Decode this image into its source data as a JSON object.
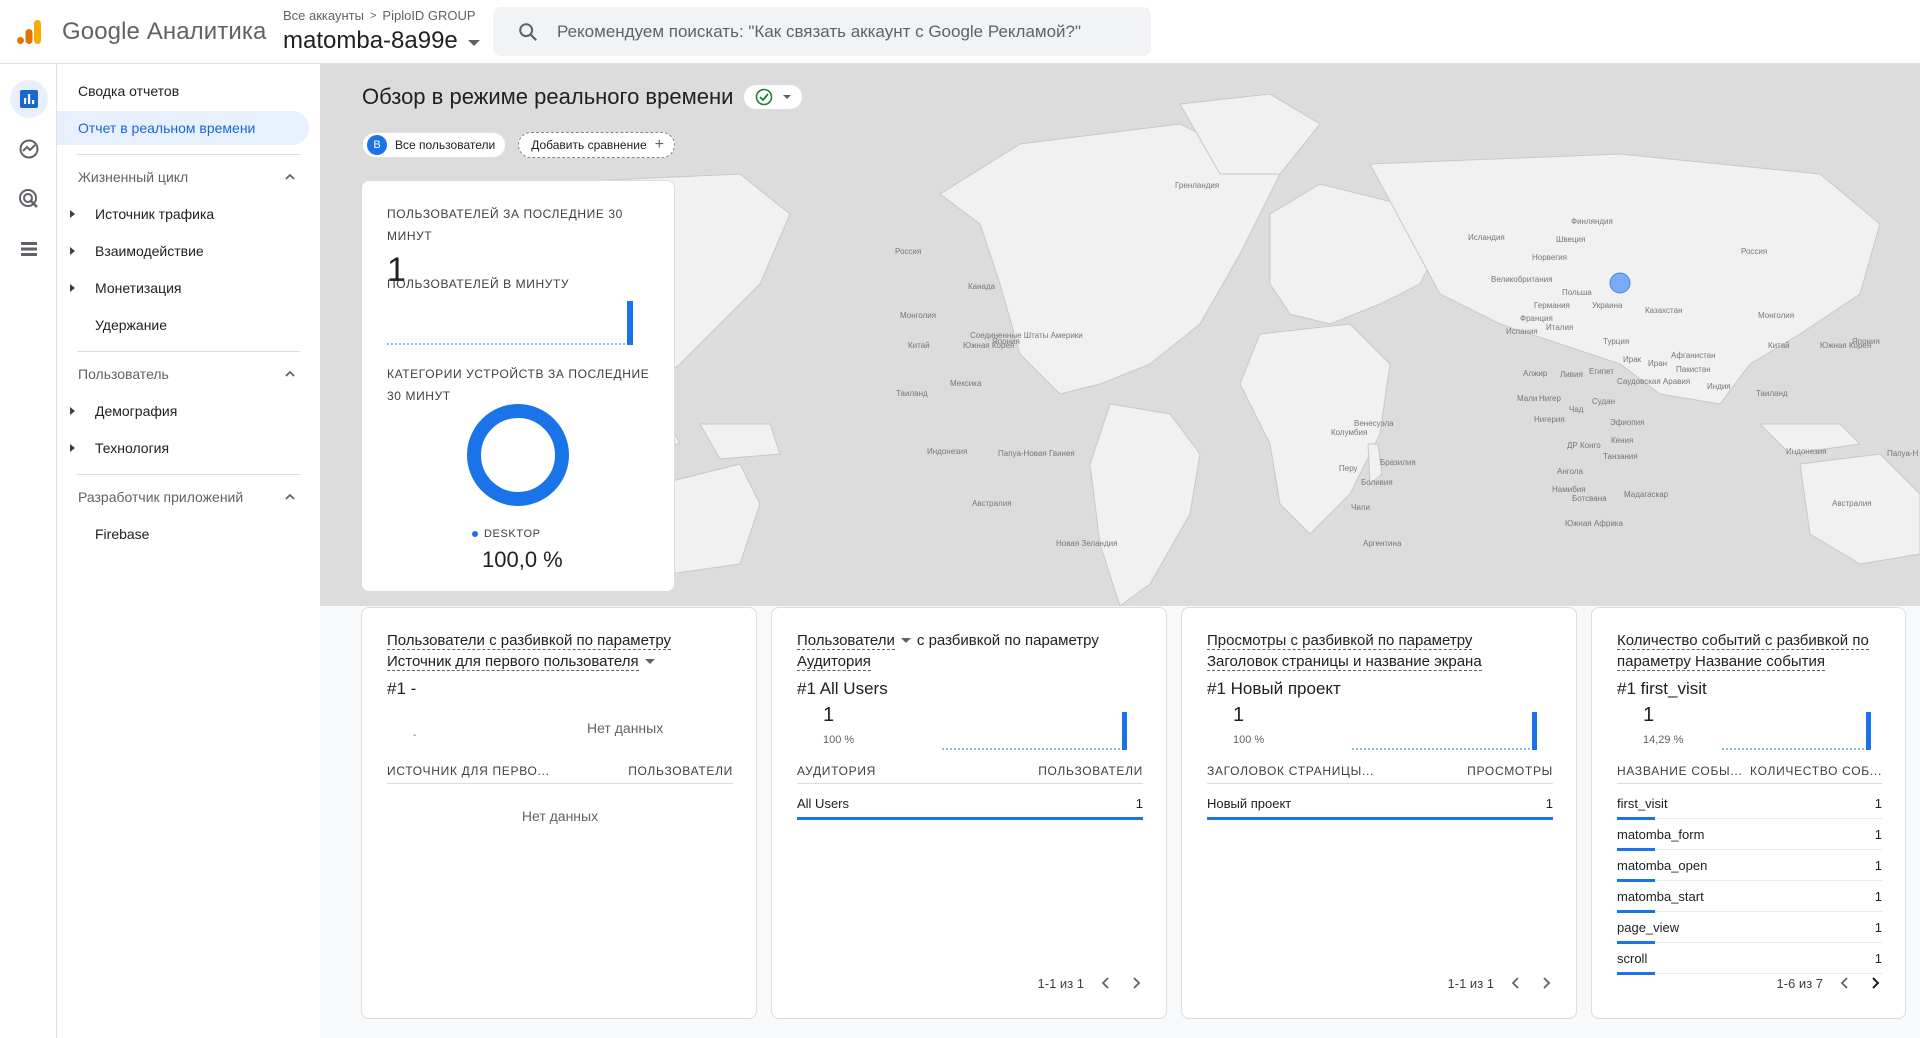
{
  "header": {
    "app_name": "Google Аналитика",
    "breadcrumb_root": "Все аккаунты",
    "breadcrumb_account": "PiploID GROUP",
    "property": "matomba-8a99e",
    "search_placeholder": "Рекомендуем поискать: \"Как связать аккаунт с Google Рекламой?\""
  },
  "rail": {
    "icons": [
      "reports-icon",
      "explore-icon",
      "advertising-icon",
      "configure-icon"
    ]
  },
  "sidebar": {
    "summary": "Сводка отчетов",
    "realtime": "Отчет в реальном времени",
    "lifecycle": "Жизненный цикл",
    "traffic": "Источник трафика",
    "engagement": "Взаимодействие",
    "monetization": "Монетизация",
    "retention": "Удержание",
    "user": "Пользователь",
    "demographics": "Демография",
    "tech": "Технология",
    "app_dev": "Разработчик приложений",
    "firebase": "Firebase"
  },
  "main": {
    "title": "Обзор в режиме реального времени",
    "segment_badge": "B",
    "segment_label": "Все пользователи",
    "add_compare": "Добавить сравнение"
  },
  "overview": {
    "label_30min": "ПОЛЬЗОВАТЕЛЕЙ ЗА ПОСЛЕДНИЕ 30 МИНУТ",
    "value": "1",
    "label_per_min": "ПОЛЬЗОВАТЕЛЕЙ В МИНУТУ",
    "label_devices": "КАТЕГОРИИ УСТРОЙСТВ ЗА ПОСЛЕДНИЕ 30 МИНУТ",
    "device_name": "DESKTOP",
    "device_pct": "100,0 %",
    "device_share": 1.0
  },
  "card1": {
    "title_a": "Пользователи с разбивкой по параметру",
    "title_b": "Источник для первого пользователя",
    "top": "#1  -",
    "top_nodata": "Нет данных",
    "col1": "ИСТОЧНИК ДЛЯ ПЕРВО...",
    "col2": "ПОЛЬЗОВАТЕЛИ",
    "nodata": "Нет данных"
  },
  "card2": {
    "title_a": "Пользователи",
    "title_b": "с разбивкой по параметру",
    "title_c": "Аудитория",
    "top": "#1  All Users",
    "num": "1",
    "pct": "100 %",
    "col1": "АУДИТОРИЯ",
    "col2": "ПОЛЬЗОВАТЕЛИ",
    "rows": [
      {
        "name": "All Users",
        "value": "1"
      }
    ],
    "pager": "1-1 из 1"
  },
  "card3": {
    "title_a": "Просмотры с разбивкой по параметру",
    "title_b": "Заголовок страницы и название экрана",
    "top": "#1  Новый проект",
    "num": "1",
    "pct": "100 %",
    "col1": "ЗАГОЛОВОК СТРАНИЦЫ...",
    "col2": "ПРОСМОТРЫ",
    "rows": [
      {
        "name": "Новый проект",
        "value": "1"
      }
    ],
    "pager": "1-1 из 1"
  },
  "card4": {
    "title_a": "Количество событий с разбивкой по",
    "title_b": "параметру Название события",
    "top": "#1  first_visit",
    "num": "1",
    "pct": "14,29 %",
    "col1": "НАЗВАНИЕ СОБЫ...",
    "col2": "КОЛИЧЕСТВО СОБ...",
    "rows": [
      {
        "name": "first_visit",
        "value": "1"
      },
      {
        "name": "matomba_form",
        "value": "1"
      },
      {
        "name": "matomba_open",
        "value": "1"
      },
      {
        "name": "matomba_start",
        "value": "1"
      },
      {
        "name": "page_view",
        "value": "1"
      },
      {
        "name": "scroll",
        "value": "1"
      }
    ],
    "pager": "1-6 из 7"
  },
  "map_labels": {
    "greenland": "Гренландия",
    "russia_w": "Россия",
    "russia_e": "Россия",
    "canada": "Канада",
    "usa": "Соединенные Штаты Америки",
    "mexico": "Мексика",
    "iceland": "Исландия",
    "norway": "Норвегия",
    "sweden": "Швеция",
    "finland": "Финляндия",
    "uk": "Великобритания",
    "poland": "Польша",
    "germany": "Германия",
    "france": "Франция",
    "ukraine": "Украина",
    "spain": "Испания",
    "italy": "Италия",
    "turkey": "Турция",
    "kazakhstan": "Казахстан",
    "mongolia_w": "Монголия",
    "mongolia_e": "Монголия",
    "china_w": "Китай",
    "china_e": "Китай",
    "japan_w": "Япония",
    "japan_e": "Япония",
    "korea_w": "Южная Корея",
    "korea_e": "Южная Корея",
    "iran": "Иран",
    "iraq": "Ирак",
    "afghanistan": "Афганистан",
    "pakistan": "Пакистан",
    "india": "Индия",
    "saudi": "Саудовская Аравия",
    "egypt": "Египет",
    "libya": "Ливия",
    "algeria": "Алжир",
    "mali": "Мали",
    "niger": "Нигер",
    "chad": "Чад",
    "sudan": "Судан",
    "nigeria": "Нигерия",
    "ethiopia": "Эфиопия",
    "kenya": "Кения",
    "drc": "ДР Конго",
    "tanzania": "Танзания",
    "angola": "Ангола",
    "namibia": "Намибия",
    "botswana": "Ботсвана",
    "sa": "Южная Африка",
    "madagascar": "Мадагаскар",
    "venezuela": "Венесуэла",
    "colombia": "Колумбия",
    "peru": "Перу",
    "brazil": "Бразилия",
    "bolivia": "Боливия",
    "chile": "Чили",
    "argentina": "Аргентина",
    "thailand_w": "Таиланд",
    "thailand_e": "Таиланд",
    "indonesia_w": "Индонезия",
    "indonesia_e": "Индонезия",
    "png": "Папуа-Новая Гвинея",
    "png_e": "Папуа-Н",
    "australia_w": "Австралия",
    "australia_e": "Австралия",
    "nz": "Новая Зеландия"
  },
  "colors": {
    "accent": "#1a73e8",
    "map_land": "#f1f1f1",
    "map_water": "#dcdcdc"
  }
}
